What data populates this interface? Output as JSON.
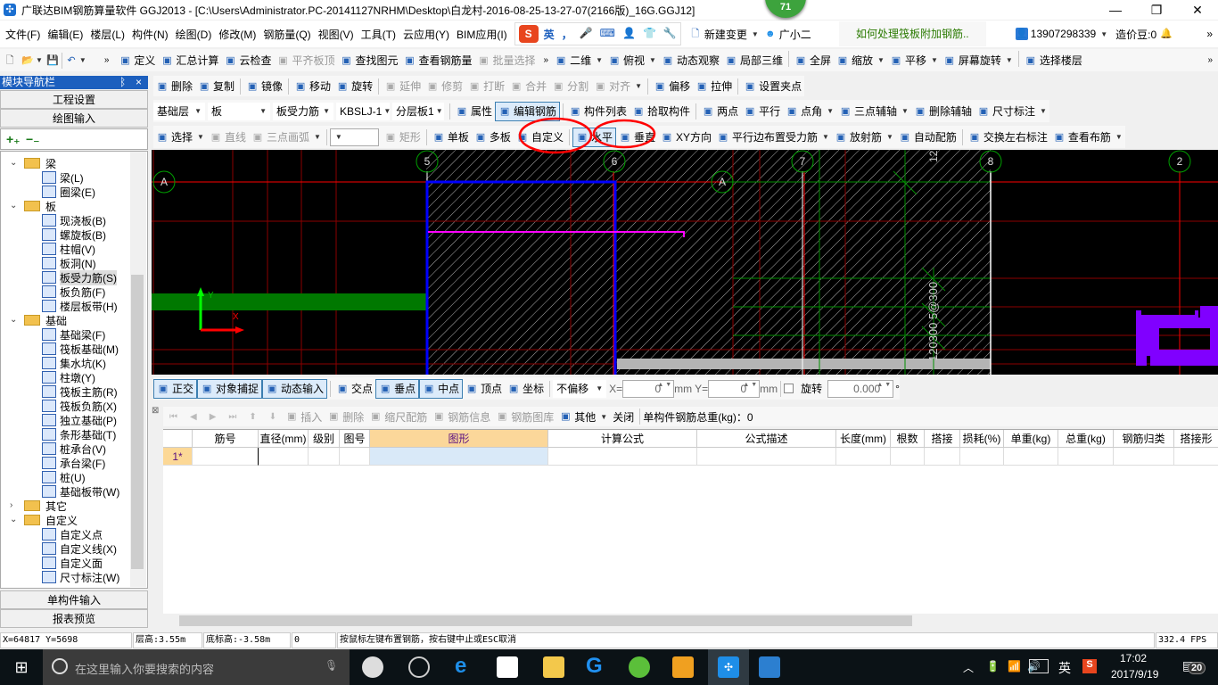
{
  "window": {
    "title": "广联达BIM钢筋算量软件 GGJ2013 - [C:\\Users\\Administrator.PC-20141127NRHM\\Desktop\\白龙村-2016-08-25-13-27-07(2166版)_16G.GGJ12]",
    "badge": "71"
  },
  "menubar": {
    "items": [
      "文件(F)",
      "编辑(E)",
      "楼层(L)",
      "构件(N)",
      "绘图(D)",
      "修改(M)",
      "钢筋量(Q)",
      "视图(V)",
      "工具(T)",
      "云应用(Y)",
      "BIM应用(I)"
    ],
    "ime": [
      "英",
      "，",
      "🎤",
      "⌨",
      "👤",
      "👕",
      "🔧"
    ],
    "new_change": "新建变更",
    "assistant": "广小二",
    "tip": "如何处理筏板附加钢筋..",
    "account": "13907298339",
    "beans": "造价豆:0"
  },
  "toolbar1": {
    "items": [
      {
        "label": "定义",
        "icon": "define-icon"
      },
      {
        "label": "汇总计算",
        "icon": "sigma-icon"
      },
      {
        "label": "云检查",
        "icon": "cloud-check-icon"
      },
      {
        "label": "平齐板顶",
        "icon": "align-top-icon",
        "disabled": true
      },
      {
        "label": "查找图元",
        "icon": "binoculars-icon"
      },
      {
        "label": "查看钢筋量",
        "icon": "rebar-qty-icon"
      },
      {
        "label": "批量选择",
        "icon": "batch-select-icon",
        "disabled": true
      }
    ],
    "view_items": [
      {
        "label": "二维",
        "icon": "2d-icon",
        "dropdown": true
      },
      {
        "label": "俯视",
        "icon": "top-view-icon",
        "dropdown": true
      },
      {
        "label": "动态观察",
        "icon": "orbit-icon"
      },
      {
        "label": "局部三维",
        "icon": "local-3d-icon"
      },
      {
        "label": "全屏",
        "icon": "fullscreen-icon"
      },
      {
        "label": "缩放",
        "icon": "zoom-icon",
        "dropdown": true
      },
      {
        "label": "平移",
        "icon": "pan-icon",
        "dropdown": true
      },
      {
        "label": "屏幕旋转",
        "icon": "rotate-screen-icon",
        "dropdown": true
      },
      {
        "label": "选择楼层",
        "icon": "select-floor-icon"
      }
    ]
  },
  "toolbar2": {
    "items": [
      {
        "label": "删除",
        "icon": "delete-icon"
      },
      {
        "label": "复制",
        "icon": "copy-icon"
      },
      {
        "label": "镜像",
        "icon": "mirror-icon"
      },
      {
        "label": "移动",
        "icon": "move-icon"
      },
      {
        "label": "旋转",
        "icon": "rotate-icon"
      },
      {
        "label": "延伸",
        "icon": "extend-icon",
        "disabled": true
      },
      {
        "label": "修剪",
        "icon": "trim-icon",
        "disabled": true
      },
      {
        "label": "打断",
        "icon": "break-icon",
        "disabled": true
      },
      {
        "label": "合并",
        "icon": "merge-icon",
        "disabled": true
      },
      {
        "label": "分割",
        "icon": "split-icon",
        "disabled": true
      },
      {
        "label": "对齐",
        "icon": "align-icon",
        "disabled": true,
        "dropdown": true
      },
      {
        "label": "偏移",
        "icon": "offset-icon"
      },
      {
        "label": "拉伸",
        "icon": "stretch-icon"
      },
      {
        "label": "设置夹点",
        "icon": "grip-icon"
      }
    ]
  },
  "toolbar3": {
    "combos": [
      "基础层",
      "板",
      "板受力筋",
      "KBSLJ-1",
      "分层板1"
    ],
    "items": [
      {
        "label": "属性",
        "icon": "properties-icon"
      },
      {
        "label": "编辑钢筋",
        "icon": "edit-rebar-icon",
        "active": true
      },
      {
        "label": "构件列表",
        "icon": "component-list-icon"
      },
      {
        "label": "拾取构件",
        "icon": "pick-icon"
      },
      {
        "label": "两点",
        "icon": "two-point-icon"
      },
      {
        "label": "平行",
        "icon": "parallel-icon"
      },
      {
        "label": "点角",
        "icon": "point-angle-icon",
        "dropdown": true
      },
      {
        "label": "三点辅轴",
        "icon": "three-point-axis-icon",
        "dropdown": true
      },
      {
        "label": "删除辅轴",
        "icon": "delete-axis-icon"
      },
      {
        "label": "尺寸标注",
        "icon": "dimension-icon",
        "dropdown": true
      }
    ]
  },
  "toolbar4": {
    "items": [
      {
        "label": "选择",
        "icon": "select-icon",
        "dropdown": true
      },
      {
        "label": "直线",
        "icon": "line-icon",
        "disabled": true
      },
      {
        "label": "三点画弧",
        "icon": "arc-icon",
        "disabled": true,
        "dropdown": true
      },
      {
        "label": "",
        "icon": "",
        "combo": true
      },
      {
        "label": "矩形",
        "icon": "rect-icon",
        "disabled": true
      },
      {
        "label": "单板",
        "icon": "single-slab-icon"
      },
      {
        "label": "多板",
        "icon": "multi-slab-icon"
      },
      {
        "label": "自定义",
        "icon": "custom-icon"
      },
      {
        "label": "水平",
        "icon": "horizontal-icon",
        "active": true
      },
      {
        "label": "垂直",
        "icon": "vertical-icon"
      },
      {
        "label": "XY方向",
        "icon": "xy-icon"
      },
      {
        "label": "平行边布置受力筋",
        "icon": "parallel-edge-icon",
        "dropdown": true
      },
      {
        "label": "放射筋",
        "icon": "radial-icon",
        "dropdown": true
      },
      {
        "label": "自动配筋",
        "icon": "auto-rebar-icon"
      },
      {
        "label": "交换左右标注",
        "icon": "swap-label-icon"
      },
      {
        "label": "查看布筋",
        "icon": "view-rebar-icon",
        "dropdown": true
      }
    ]
  },
  "nav": {
    "title": "模块导航栏",
    "project_settings": "工程设置",
    "drawing_input": "绘图输入",
    "single_input": "单构件输入",
    "report_preview": "报表预览",
    "tree": [
      {
        "label": "梁",
        "level": 0,
        "folder": true,
        "open": true
      },
      {
        "label": "梁(L)",
        "level": 1
      },
      {
        "label": "圈梁(E)",
        "level": 1
      },
      {
        "label": "板",
        "level": 0,
        "folder": true,
        "open": true
      },
      {
        "label": "现浇板(B)",
        "level": 1
      },
      {
        "label": "螺旋板(B)",
        "level": 1
      },
      {
        "label": "柱帽(V)",
        "level": 1
      },
      {
        "label": "板洞(N)",
        "level": 1
      },
      {
        "label": "板受力筋(S)",
        "level": 1,
        "selected": true
      },
      {
        "label": "板负筋(F)",
        "level": 1
      },
      {
        "label": "楼层板带(H)",
        "level": 1
      },
      {
        "label": "基础",
        "level": 0,
        "folder": true,
        "open": true
      },
      {
        "label": "基础梁(F)",
        "level": 1
      },
      {
        "label": "筏板基础(M)",
        "level": 1
      },
      {
        "label": "集水坑(K)",
        "level": 1
      },
      {
        "label": "柱墩(Y)",
        "level": 1
      },
      {
        "label": "筏板主筋(R)",
        "level": 1
      },
      {
        "label": "筏板负筋(X)",
        "level": 1
      },
      {
        "label": "独立基础(P)",
        "level": 1
      },
      {
        "label": "条形基础(T)",
        "level": 1
      },
      {
        "label": "桩承台(V)",
        "level": 1
      },
      {
        "label": "承台梁(F)",
        "level": 1
      },
      {
        "label": "桩(U)",
        "level": 1
      },
      {
        "label": "基础板带(W)",
        "level": 1
      },
      {
        "label": "其它",
        "level": 0,
        "folder": true,
        "open": false
      },
      {
        "label": "自定义",
        "level": 0,
        "folder": true,
        "open": true
      },
      {
        "label": "自定义点",
        "level": 1
      },
      {
        "label": "自定义线(X)",
        "level": 1
      },
      {
        "label": "自定义面",
        "level": 1
      },
      {
        "label": "尺寸标注(W)",
        "level": 1
      }
    ]
  },
  "canvas": {
    "axis_labels": [
      "A",
      "5",
      "6",
      "A",
      "7",
      "8",
      "2"
    ],
    "rebar_text": "120300 5@300",
    "top_text": "12",
    "ucs_x": "X",
    "ucs_y": "Y",
    "colors": {
      "background": "#000000",
      "grid": "#8b0000",
      "slab_outline": "#0000ff",
      "rebar": "#ff00ff",
      "beam": "#007800",
      "purple": "#8000ff"
    }
  },
  "snapbar": {
    "items": [
      {
        "label": "正交",
        "icon": "ortho-icon",
        "active": true
      },
      {
        "label": "对象捕捉",
        "icon": "osnap-icon",
        "active": true
      },
      {
        "label": "动态输入",
        "icon": "dyn-input-icon",
        "active": true
      },
      {
        "label": "交点",
        "icon": "intersection-icon"
      },
      {
        "label": "垂点",
        "icon": "perpendicular-icon",
        "active": true
      },
      {
        "label": "中点",
        "icon": "midpoint-icon",
        "active": true
      },
      {
        "label": "顶点",
        "icon": "vertex-icon"
      },
      {
        "label": "坐标",
        "icon": "coordinate-icon"
      }
    ],
    "offset": "不偏移",
    "x_label": "X=",
    "x_value": "0",
    "y_label": "Y=",
    "y_value": "0",
    "unit": "mm",
    "rotate_label": "旋转",
    "rotate_value": "0.000",
    "degree": "°"
  },
  "rebar_toolbar": {
    "items": [
      {
        "label": "插入",
        "icon": "insert-icon",
        "disabled": true
      },
      {
        "label": "删除",
        "icon": "delete-row-icon",
        "disabled": true
      },
      {
        "label": "缩尺配筋",
        "icon": "scale-rebar-icon",
        "disabled": true
      },
      {
        "label": "钢筋信息",
        "icon": "rebar-info-icon",
        "disabled": true
      },
      {
        "label": "钢筋图库",
        "icon": "rebar-library-icon",
        "disabled": true
      },
      {
        "label": "其他",
        "icon": "other-icon",
        "dropdown": true
      },
      {
        "label": "关闭",
        "icon": ""
      }
    ],
    "total": "单构件钢筋总重(kg)：0"
  },
  "table": {
    "columns": [
      "筋号",
      "直径(mm)",
      "级别",
      "图号",
      "图形",
      "计算公式",
      "公式描述",
      "长度(mm)",
      "根数",
      "搭接",
      "损耗(%)",
      "单重(kg)",
      "总重(kg)",
      "钢筋归类",
      "搭接形"
    ],
    "rows": [
      {
        "header": "1*",
        "cells": [
          "",
          "",
          "",
          "",
          "",
          "",
          "",
          "",
          "",
          "",
          "",
          "",
          "",
          "",
          ""
        ]
      }
    ]
  },
  "status": {
    "coords": "X=64817 Y=5698",
    "floor_height": "层高:3.55m",
    "bottom_elev": "底标高:-3.58m",
    "count": "0",
    "hint": "按鼠标左键布置钢筋，按右键中止或ESC取消",
    "fps": "332.4 FPS"
  },
  "taskbar": {
    "search_placeholder": "在这里输入你要搜索的内容",
    "tray_lang": "英",
    "time": "17:02",
    "date": "2017/9/19",
    "notifications": "20"
  }
}
